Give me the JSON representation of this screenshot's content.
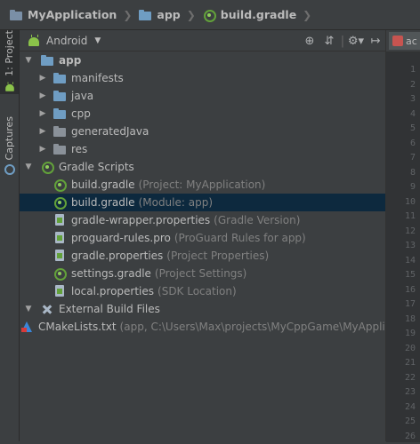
{
  "breadcrumb": [
    {
      "label": "MyApplication",
      "icon": "folder-icon"
    },
    {
      "label": "app",
      "icon": "folder-icon"
    },
    {
      "label": "build.gradle",
      "icon": "gradle-icon"
    }
  ],
  "side_tabs": [
    {
      "label": "1: Project",
      "icon": "android-icon"
    },
    {
      "label": "Captures",
      "icon": "camera-icon"
    }
  ],
  "panel": {
    "view_selector": "Android",
    "tools": [
      "sync-icon",
      "collapse-icon",
      "gear-icon",
      "hide-icon"
    ]
  },
  "tree": [
    {
      "name": "app",
      "hint": "",
      "arrow": "▼",
      "icon": "folder-icon",
      "bold": true
    },
    {
      "name": "manifests",
      "hint": "",
      "arrow": "▶",
      "icon": "folder-icon"
    },
    {
      "name": "java",
      "hint": "",
      "arrow": "▶",
      "icon": "folder-icon"
    },
    {
      "name": "cpp",
      "hint": "",
      "arrow": "▶",
      "icon": "folder-icon"
    },
    {
      "name": "generatedJava",
      "hint": "",
      "arrow": "▶",
      "icon": "folder-icon"
    },
    {
      "name": "res",
      "hint": "",
      "arrow": "▶",
      "icon": "folder-icon"
    },
    {
      "name": "Gradle Scripts",
      "hint": "",
      "arrow": "▼",
      "icon": "gradle-icon"
    },
    {
      "name": "build.gradle",
      "hint": "(Project: MyApplication)",
      "arrow": "",
      "icon": "gradle-icon"
    },
    {
      "name": "build.gradle",
      "hint": "(Module: app)",
      "arrow": "",
      "icon": "gradle-icon",
      "selected": true
    },
    {
      "name": "gradle-wrapper.properties",
      "hint": "(Gradle Version)",
      "arrow": "",
      "icon": "properties-file-icon"
    },
    {
      "name": "proguard-rules.pro",
      "hint": "(ProGuard Rules for app)",
      "arrow": "",
      "icon": "properties-file-icon"
    },
    {
      "name": "gradle.properties",
      "hint": "(Project Properties)",
      "arrow": "",
      "icon": "properties-file-icon"
    },
    {
      "name": "settings.gradle",
      "hint": "(Project Settings)",
      "arrow": "",
      "icon": "gradle-icon"
    },
    {
      "name": "local.properties",
      "hint": "(SDK Location)",
      "arrow": "",
      "icon": "properties-file-icon"
    },
    {
      "name": "External Build Files",
      "hint": "",
      "arrow": "▼",
      "icon": "tools-icon"
    },
    {
      "name": "CMakeLists.txt",
      "hint": "(app, C:\\Users\\Max\\projects\\MyCppGame\\MyApplic",
      "arrow": "",
      "icon": "cmake-icon"
    }
  ],
  "editor": {
    "tab_label": "ac",
    "line_numbers": [
      "1",
      "2",
      "3",
      "4",
      "5",
      "6",
      "7",
      "8",
      "9",
      "10",
      "11",
      "12",
      "13",
      "14",
      "15",
      "16",
      "17",
      "18",
      "19",
      "20",
      "21",
      "22",
      "23",
      "24",
      "25",
      "26"
    ]
  }
}
